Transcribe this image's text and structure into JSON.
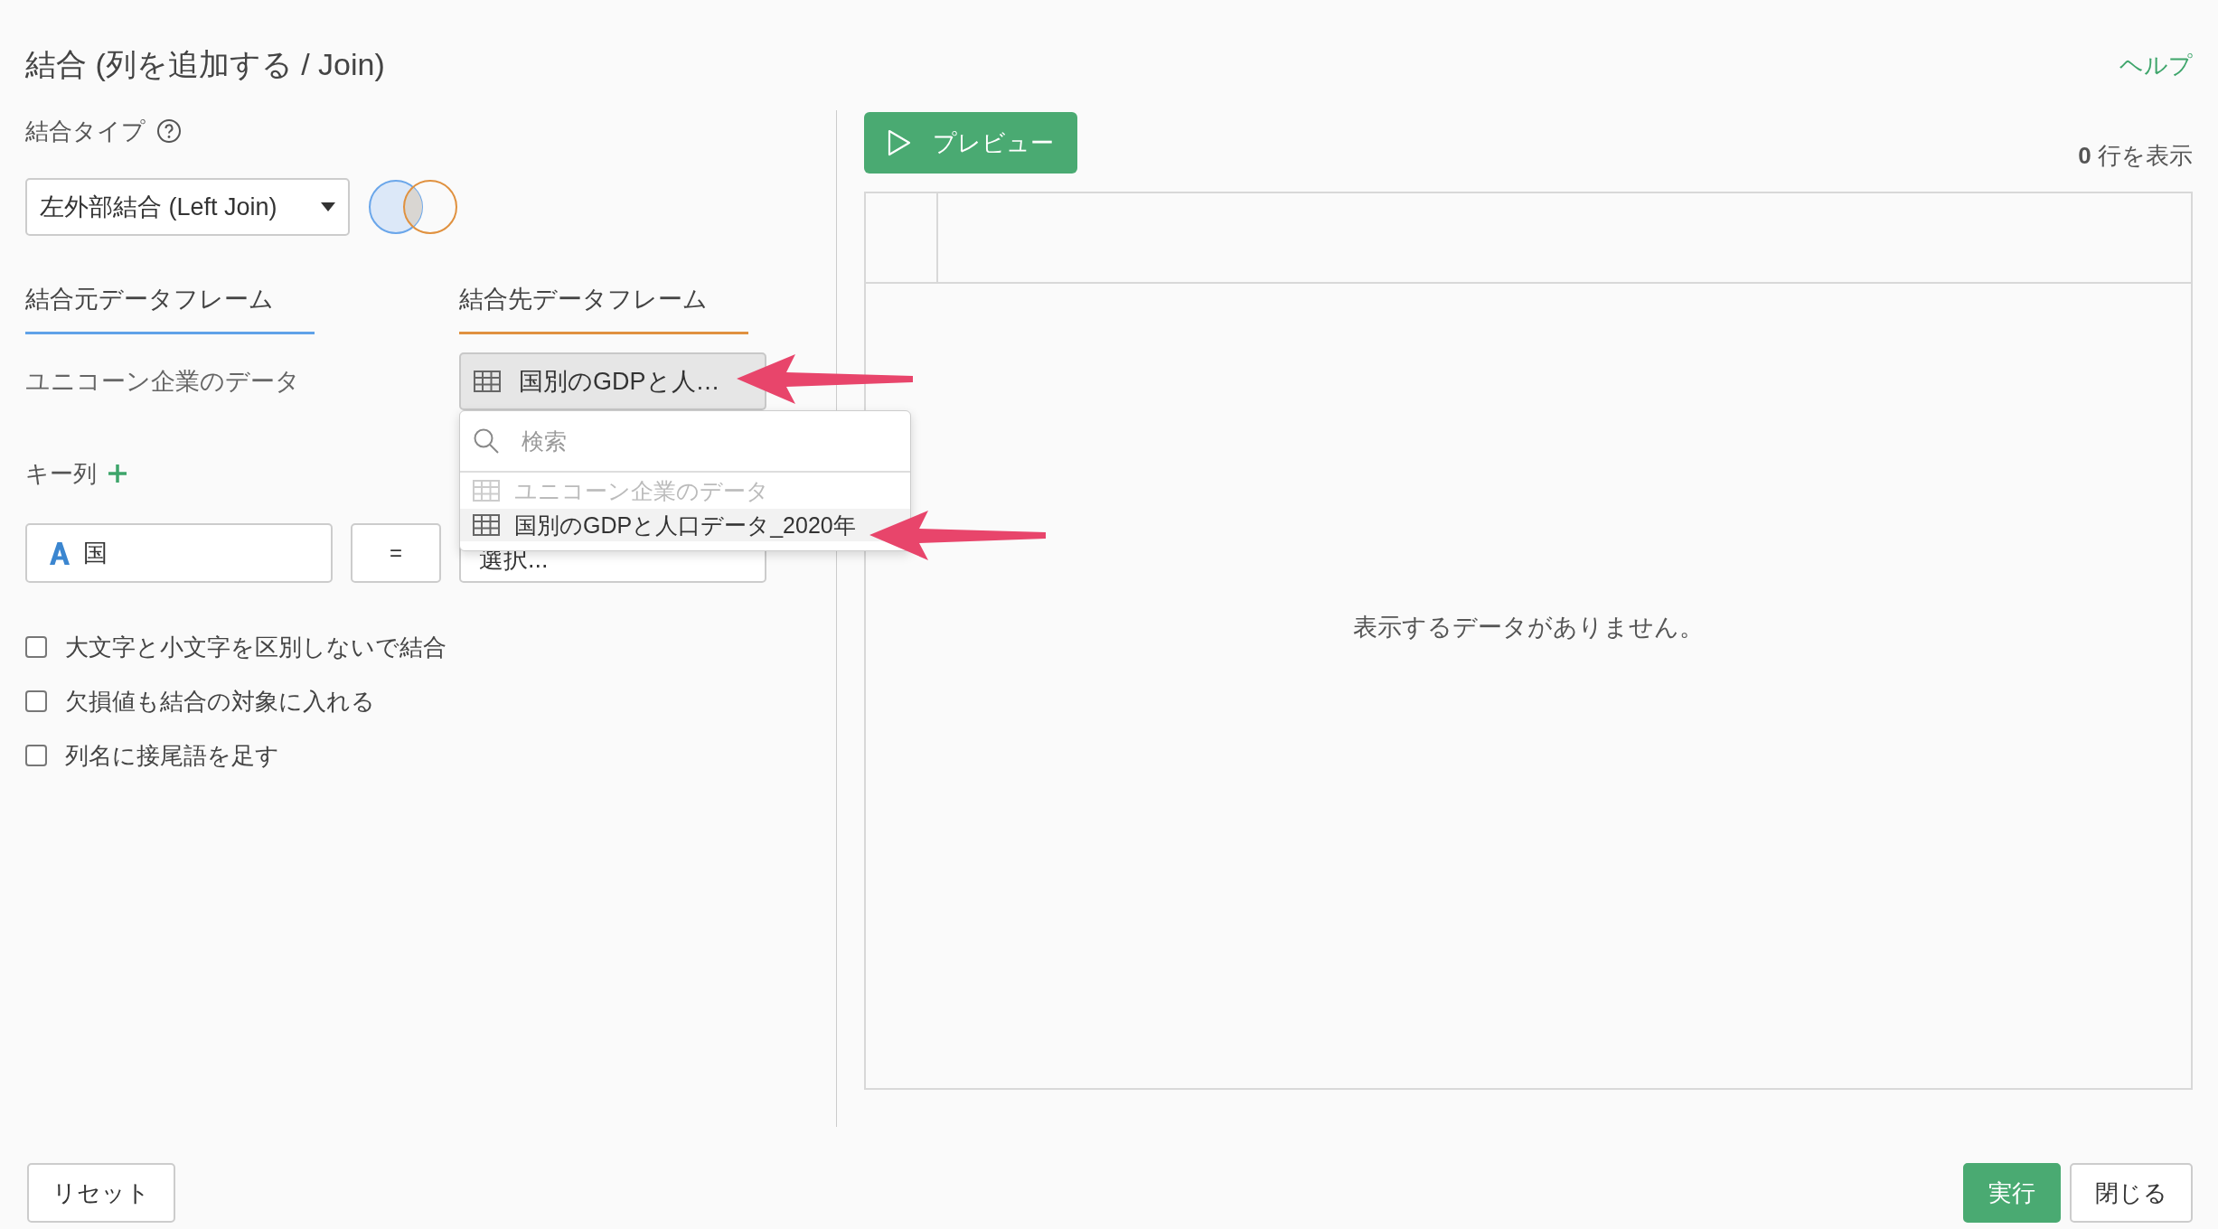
{
  "header": {
    "title": "結合 (列を追加する / Join)",
    "help_link": "ヘルプ"
  },
  "join_type": {
    "label": "結合タイプ",
    "select_value": "左外部結合 (Left Join)"
  },
  "dataframe_tabs": [
    {
      "label": "結合元データフレーム",
      "color": "#5fa2e8"
    },
    {
      "label": "結合先データフレーム",
      "color": "#e0913f"
    }
  ],
  "source_dataframe": "ユニコーン企業のデータ",
  "target_dataframe": {
    "value": "国別のGDPと人…",
    "expanded": true
  },
  "dropdown": {
    "search_placeholder": "検索",
    "items": [
      {
        "label": "ユニコーン企業のデータ",
        "disabled": true,
        "selected": false
      },
      {
        "label": "国別のGDPと人口データ_2020年",
        "disabled": false,
        "selected": true
      }
    ]
  },
  "key_columns": {
    "label": "キー列",
    "rows": [
      {
        "left": "国",
        "operator": "=",
        "right": "選択..."
      }
    ]
  },
  "options": [
    {
      "label": "大文字と小文字を区別しないで結合",
      "checked": false
    },
    {
      "label": "欠損値も結合の対象に入れる",
      "checked": false
    },
    {
      "label": "列名に接尾語を足す",
      "checked": false
    }
  ],
  "preview": {
    "button": "プレビュー",
    "row_count": "**0** 行を表示",
    "empty_message": "表示するデータがありません。"
  },
  "footer": {
    "reset": "リセット",
    "run": "実行",
    "close": "閉じる"
  }
}
